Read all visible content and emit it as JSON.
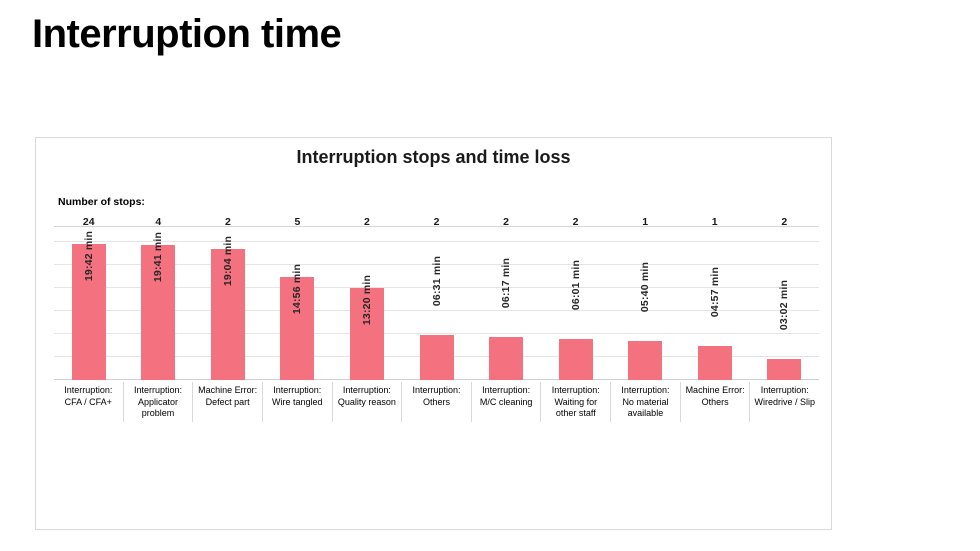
{
  "slide": {
    "title": "Interruption time"
  },
  "chart_card": {
    "chart_title": "Interruption stops and time loss",
    "stops_caption": "Number of stops:"
  },
  "chart_data": {
    "type": "bar",
    "title": "Interruption stops and time loss",
    "xlabel": "",
    "ylabel": "",
    "grid": true,
    "legend": "none",
    "ylim": [
      0,
      1200
    ],
    "value_unit": "min",
    "categories": [
      "Interruption:\nCFA / CFA+",
      "Interruption:\nApplicator problem",
      "Machine Error:\nDefect part",
      "Interruption:\nWire tangled",
      "Interruption:\nQuality reason",
      "Interruption:\nOthers",
      "Interruption:\nM/C cleaning",
      "Interruption:\nWaiting for other staff",
      "Interruption:\nNo material available",
      "Machine Error:\nOthers",
      "Interruption:\nWiredrive / Slip"
    ],
    "category_lines": [
      [
        "Interruption:",
        "CFA / CFA+"
      ],
      [
        "Interruption:",
        "Applicator",
        "problem"
      ],
      [
        "Machine Error:",
        "Defect part"
      ],
      [
        "Interruption:",
        "Wire tangled"
      ],
      [
        "Interruption:",
        "Quality reason"
      ],
      [
        "Interruption:",
        "Others"
      ],
      [
        "Interruption:",
        "M/C cleaning"
      ],
      [
        "Interruption:",
        "Waiting for",
        "other staff"
      ],
      [
        "Interruption:",
        "No material",
        "available"
      ],
      [
        "Machine Error:",
        "Others"
      ],
      [
        "Interruption:",
        "Wiredrive / Slip"
      ]
    ],
    "value_labels": [
      "19:42 min",
      "19:41 min",
      "19:04 min",
      "14:56 min",
      "13:20 min",
      "06:31 min",
      "06:17 min",
      "06:01 min",
      "05:40 min",
      "04:57 min",
      "03:02 min"
    ],
    "values_seconds": [
      1182,
      1181,
      1144,
      896,
      800,
      391,
      377,
      361,
      340,
      297,
      182
    ],
    "values_minutes": [
      19.7,
      19.68,
      19.07,
      14.93,
      13.33,
      6.52,
      6.28,
      6.02,
      5.67,
      4.95,
      3.03
    ],
    "number_of_stops": [
      24,
      4,
      2,
      5,
      2,
      2,
      2,
      2,
      1,
      1,
      2
    ],
    "bar_color": "#f4717f",
    "label_placement": [
      "inside",
      "inside",
      "inside",
      "inside",
      "inside",
      "outside",
      "outside",
      "outside",
      "outside",
      "outside",
      "outside"
    ]
  }
}
